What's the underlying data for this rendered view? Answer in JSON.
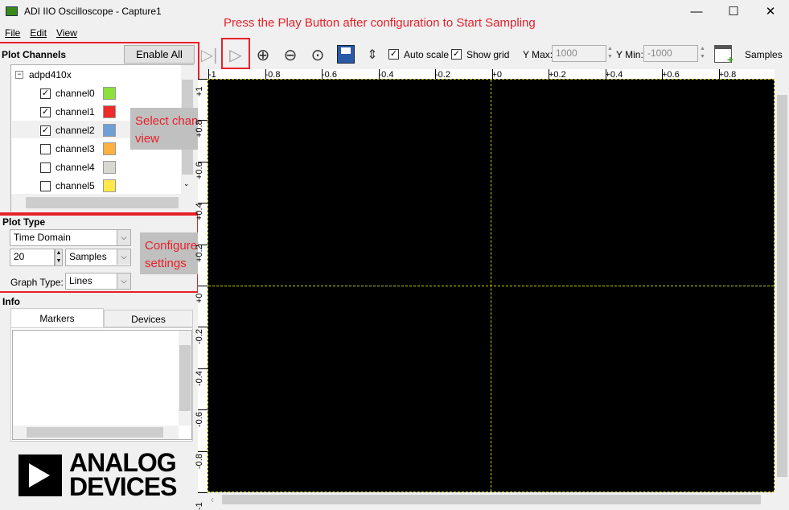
{
  "window": {
    "title": "ADI IIO Oscilloscope - Capture1",
    "minimize": "—",
    "maximize": "☐",
    "close": "✕"
  },
  "menu": [
    "File",
    "Edit",
    "View"
  ],
  "annotations": {
    "play": "Press the Play Button after configuration to Start Sampling",
    "channels": "Select channels to view",
    "plot": "Configure plot settings"
  },
  "plot_channels": {
    "title": "Plot Channels",
    "enable_all": "Enable All",
    "device": "adpd410x",
    "channels": [
      {
        "name": "channel0",
        "checked": true,
        "color": "#8be03a"
      },
      {
        "name": "channel1",
        "checked": true,
        "color": "#ee2a2a"
      },
      {
        "name": "channel2",
        "checked": true,
        "color": "#6f9fd8"
      },
      {
        "name": "channel3",
        "checked": false,
        "color": "#fbb040"
      },
      {
        "name": "channel4",
        "checked": false,
        "color": "#d8d8d0"
      },
      {
        "name": "channel5",
        "checked": false,
        "color": "#ffe84a"
      }
    ]
  },
  "plot_type": {
    "title": "Plot Type",
    "domain": "Time Domain",
    "samples_value": "20",
    "samples_unit": "Samples",
    "graph_type_label": "Graph Type:",
    "graph_type": "Lines"
  },
  "info": {
    "title": "Info",
    "tabs": [
      "Markers",
      "Devices"
    ]
  },
  "logo": {
    "line1": "ANALOG",
    "line2": "DEVICES"
  },
  "toolbar": {
    "auto_scale": "Auto scale",
    "show_grid": "Show grid",
    "ymax_label": "Y Max:",
    "ymax": "1000",
    "ymin_label": "Y Min:",
    "ymin": "-1000",
    "samples": "Samples"
  },
  "axes": {
    "x": [
      "-1",
      "-0.8",
      "-0.6",
      "-0.4",
      "-0.2",
      "+0",
      "+0.2",
      "+0.4",
      "+0.6",
      "+0.8"
    ],
    "y": [
      "+1",
      "+0.8",
      "+0.6",
      "+0.4",
      "+0.2",
      "+0",
      "-0.2",
      "-0.4",
      "-0.6",
      "-0.8",
      "-1"
    ]
  }
}
